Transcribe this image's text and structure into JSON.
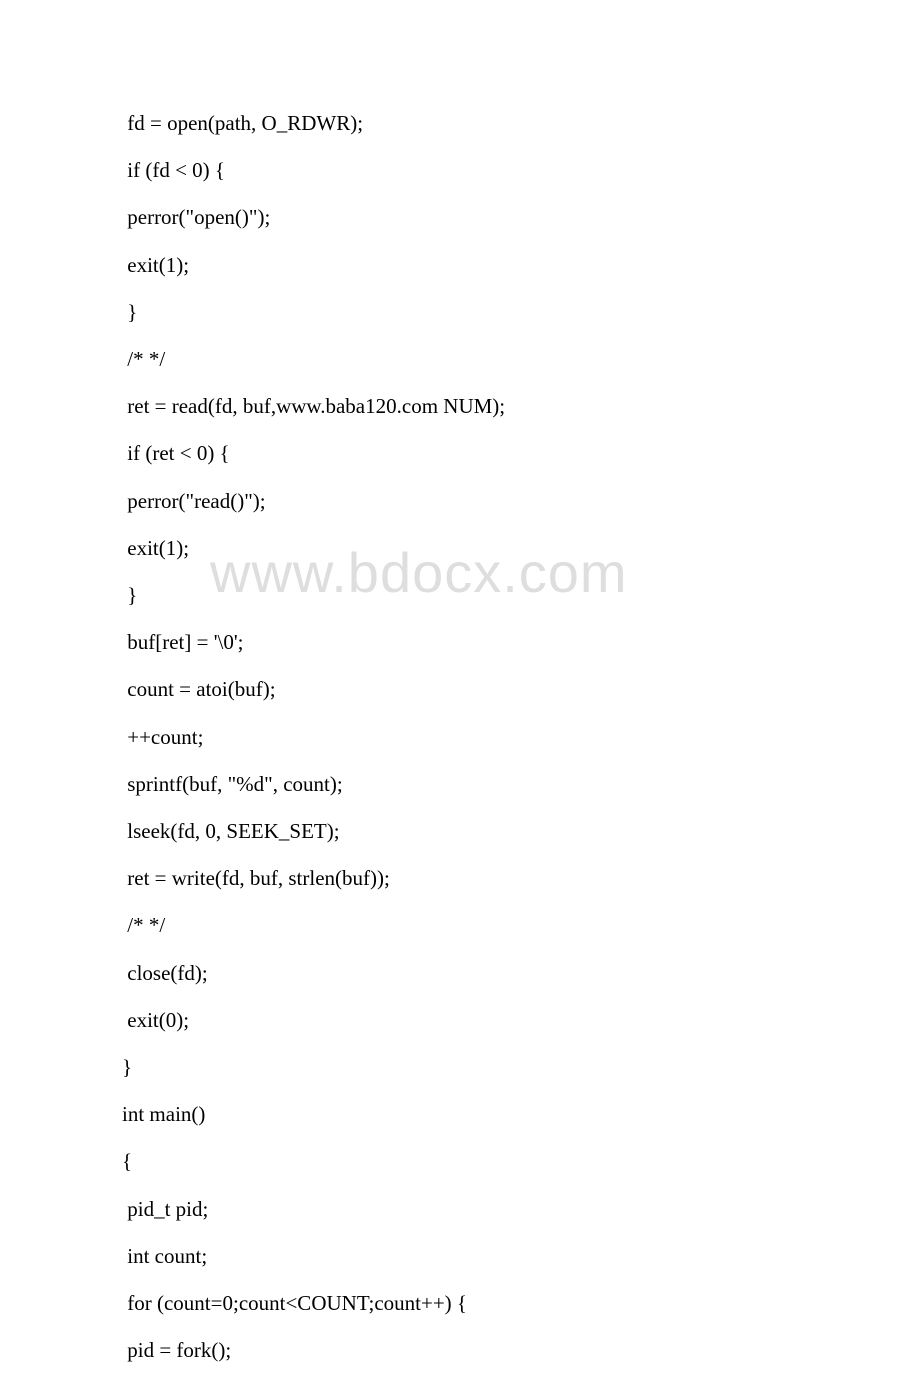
{
  "watermark": "www.bdocx.com",
  "code": {
    "lines": [
      " fd = open(path, O_RDWR);",
      " if (fd < 0) {",
      " perror(\"open()\");",
      " exit(1);",
      " }",
      " /* */",
      " ret = read(fd, buf,www.baba120.com NUM);",
      " if (ret < 0) {",
      " perror(\"read()\");",
      " exit(1);",
      " }",
      " buf[ret] = '\\0';",
      " count = atoi(buf);",
      " ++count;",
      " sprintf(buf, \"%d\", count);",
      " lseek(fd, 0, SEEK_SET);",
      " ret = write(fd, buf, strlen(buf));",
      " /* */",
      " close(fd);",
      " exit(0);",
      "}",
      "int main()",
      "{",
      " pid_t pid;",
      " int count;",
      " for (count=0;count<COUNT;count++) {",
      " pid = fork();"
    ]
  }
}
